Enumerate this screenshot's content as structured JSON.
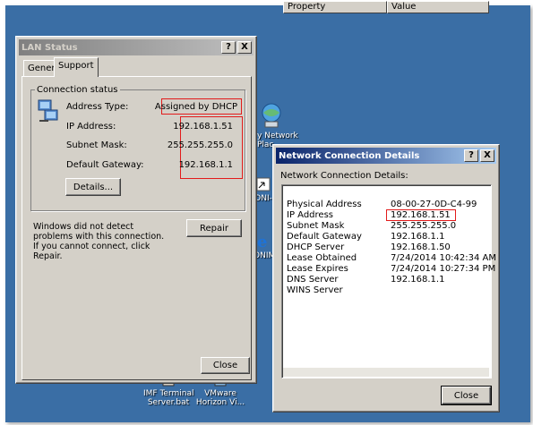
{
  "desktop": {
    "icons": [
      {
        "label": "y Network\nPlac"
      },
      {
        "label": "ONI-"
      },
      {
        "label": "ONIM"
      },
      {
        "label": "IMF Terminal\nServer.bat"
      },
      {
        "label": "VMware\nHorizon Vi..."
      }
    ]
  },
  "lan_window": {
    "title": "LAN Status",
    "help_btn": "?",
    "close_btn": "X",
    "tabs": [
      "General",
      "Support"
    ],
    "group_label": "Connection status",
    "rows": [
      {
        "label": "Address Type:",
        "value": "Assigned by DHCP"
      },
      {
        "label": "IP Address:",
        "value": "192.168.1.51"
      },
      {
        "label": "Subnet Mask:",
        "value": "255.255.255.0"
      },
      {
        "label": "Default Gateway:",
        "value": "192.168.1.1"
      }
    ],
    "details_btn": "Details...",
    "info_text": "Windows did not detect problems with this connection. If you cannot connect, click Repair.",
    "repair_btn": "Repair",
    "close_label": "Close"
  },
  "details_window": {
    "title": "Network Connection Details",
    "help_btn": "?",
    "close_btn": "X",
    "caption": "Network Connection Details:",
    "columns": [
      "Property",
      "Value"
    ],
    "rows": [
      {
        "property": "Physical Address",
        "value": "08-00-27-0D-C4-99"
      },
      {
        "property": "IP Address",
        "value": "192.168.1.51"
      },
      {
        "property": "Subnet Mask",
        "value": "255.255.255.0"
      },
      {
        "property": "Default Gateway",
        "value": "192.168.1.1"
      },
      {
        "property": "DHCP Server",
        "value": "192.168.1.50"
      },
      {
        "property": "Lease Obtained",
        "value": "7/24/2014 10:42:34 AM"
      },
      {
        "property": "Lease Expires",
        "value": "7/24/2014 10:27:34 PM"
      },
      {
        "property": "DNS Server",
        "value": "192.168.1.1"
      },
      {
        "property": "WINS Server",
        "value": ""
      }
    ],
    "close_label": "Close"
  },
  "colors": {
    "desktop": "#3a6ea5",
    "highlight": "#e21b1b",
    "title_active": "#0a246a"
  }
}
